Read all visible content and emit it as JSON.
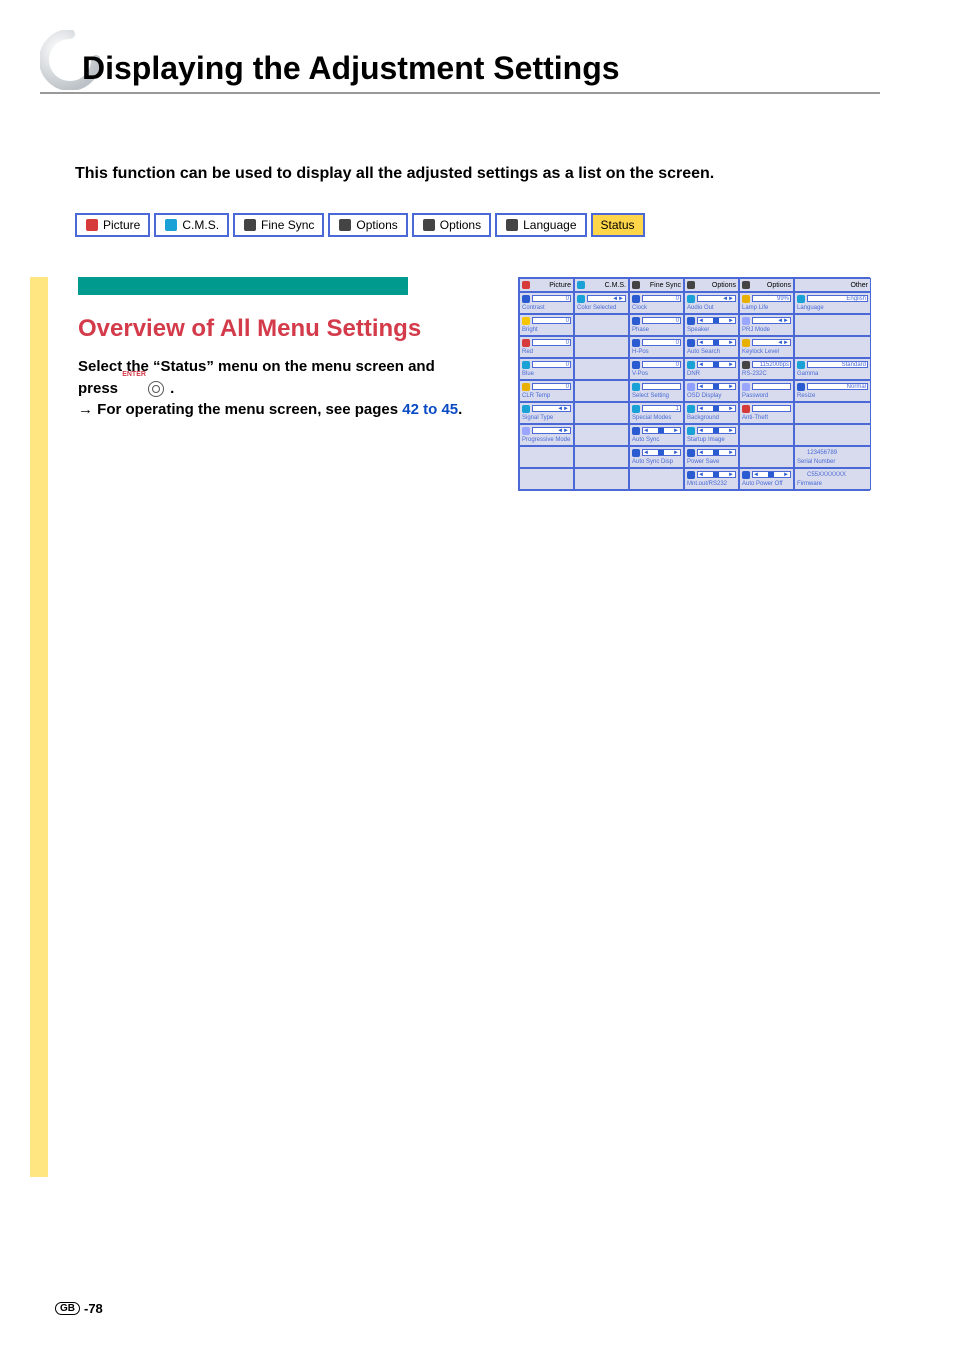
{
  "title": "Displaying the Adjustment Settings",
  "intro": "This function can be used to display all the adjusted settings as a list on the screen.",
  "tabs": [
    "Picture",
    "C.M.S.",
    "Fine Sync",
    "Options",
    "Options",
    "Language",
    "Status"
  ],
  "tab_icons": [
    "picture-icon",
    "cms-icon",
    "fine-sync-icon",
    "options-icon",
    "options-icon",
    "language-icon",
    ""
  ],
  "section_title": "Overview of All Menu Settings",
  "instruction_line1": "Select the “Status” menu on the menu screen and press ",
  "enter_label": "ENTER",
  "instruction_line1_end": " .",
  "instruction_arrow": "→ ",
  "instruction_line2a": "For operating the menu screen, see pages ",
  "instruction_link": "42 to 45",
  "instruction_line2b": ".",
  "page_badge": "GB",
  "page_num": "-78",
  "status_table": {
    "headers": [
      "Picture",
      "C.M.S.",
      "Fine Sync",
      "Options",
      "Options",
      "Other"
    ],
    "rows": [
      [
        {
          "label": "Contrast",
          "value": "0",
          "icon": "#2b5bd0",
          "type": "slider"
        },
        {
          "label": "Color Selected",
          "value": "",
          "icon": "#1aa1d6",
          "type": "arrows"
        },
        {
          "label": "Clock",
          "value": "0",
          "icon": "#2b5bd0",
          "type": "slider"
        },
        {
          "label": "Audio Out",
          "value": "",
          "icon": "#1aa1d6",
          "type": "arrows"
        },
        {
          "label": "Lamp Life",
          "value": "99%",
          "icon": "#e8b000",
          "type": "val"
        },
        {
          "label": "Language",
          "value": "English",
          "icon": "#1aa1d6",
          "type": "val"
        }
      ],
      [
        {
          "label": "Bright",
          "value": "0",
          "icon": "#f6c700",
          "type": "slider"
        },
        null,
        {
          "label": "Phase",
          "value": "0",
          "icon": "#2b5bd0",
          "type": "slider"
        },
        {
          "label": "Speaker",
          "value": "",
          "icon": "#2b5bd0",
          "type": "toggle"
        },
        {
          "label": "PRJ Mode",
          "value": "",
          "icon": "#9aa6ff",
          "type": "arrows"
        },
        null
      ],
      [
        {
          "label": "Red",
          "value": "0",
          "icon": "#d63a3a",
          "type": "slider"
        },
        null,
        {
          "label": "H-Pos",
          "value": "0",
          "icon": "#2b5bd0",
          "type": "slider"
        },
        {
          "label": "Auto Search",
          "value": "",
          "icon": "#2b5bd0",
          "type": "toggle"
        },
        {
          "label": "Keylock Level",
          "value": "",
          "icon": "#e8b000",
          "type": "arrows"
        },
        null
      ],
      [
        {
          "label": "Blue",
          "value": "0",
          "icon": "#1aa1d6",
          "type": "slider"
        },
        null,
        {
          "label": "V-Pos",
          "value": "0",
          "icon": "#2b5bd0",
          "type": "slider"
        },
        {
          "label": "DNR",
          "value": "",
          "icon": "#1aa1d6",
          "type": "toggle"
        },
        {
          "label": "RS-232C",
          "value": "115200bps",
          "icon": "#444",
          "type": "val"
        },
        {
          "label": "Gamma",
          "value": "Standard",
          "icon": "#1aa1d6",
          "type": "val"
        }
      ],
      [
        {
          "label": "CLR Temp",
          "value": "0",
          "icon": "#e8b000",
          "type": "slider"
        },
        null,
        {
          "label": "Select Setting",
          "value": "",
          "icon": "#1aa1d6",
          "type": "menu"
        },
        {
          "label": "OSD Display",
          "value": "",
          "icon": "#8fa0ff",
          "type": "toggle"
        },
        {
          "label": "Password",
          "value": "",
          "icon": "#9aa6ff",
          "type": "val"
        },
        {
          "label": "Resize",
          "value": "Normal",
          "icon": "#2b5bd0",
          "type": "val"
        }
      ],
      [
        {
          "label": "Signal Type",
          "value": "",
          "icon": "#1aa1d6",
          "type": "arrows"
        },
        null,
        {
          "label": "Special Modes",
          "value": "1",
          "icon": "#1aa1d6",
          "type": "val"
        },
        {
          "label": "Background",
          "value": "",
          "icon": "#1aa1d6",
          "type": "toggle"
        },
        {
          "label": "Anti-Theft",
          "value": "",
          "icon": "#d63a3a",
          "type": "val"
        },
        null
      ],
      [
        {
          "label": "Progressive Mode",
          "value": "",
          "icon": "#9aa6ff",
          "type": "arrows"
        },
        null,
        {
          "label": "Auto Sync",
          "value": "",
          "icon": "#2b5bd0",
          "type": "toggle"
        },
        {
          "label": "Startup Image",
          "value": "",
          "icon": "#1aa1d6",
          "type": "toggle"
        },
        null,
        null
      ],
      [
        null,
        null,
        {
          "label": "Auto Sync Disp",
          "value": "",
          "icon": "#2b5bd0",
          "type": "toggle"
        },
        {
          "label": "Power Save",
          "value": "",
          "icon": "#2b5bd0",
          "type": "toggle"
        },
        null,
        {
          "label": "Serial Number",
          "value": "123456789",
          "icon": "",
          "type": "text"
        }
      ],
      [
        null,
        null,
        null,
        {
          "label": "Mnt.out/RS232",
          "value": "",
          "icon": "#2b5bd0",
          "type": "toggle"
        },
        {
          "label": "Auto Power Off",
          "value": "",
          "icon": "#2b5bd0",
          "type": "toggle"
        },
        {
          "label": "Firmware",
          "value": "C55XXXXXXX",
          "icon": "",
          "type": "text"
        }
      ]
    ]
  }
}
